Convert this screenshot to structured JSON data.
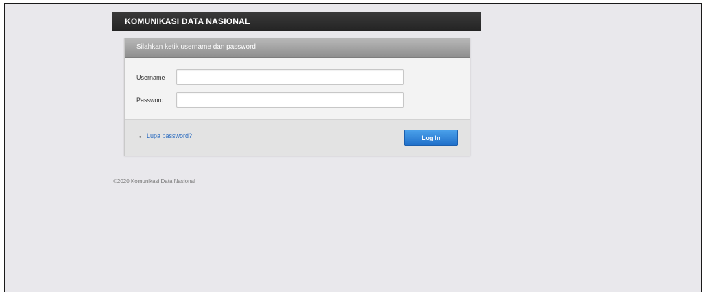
{
  "header": {
    "title": "KOMUNIKASI DATA NASIONAL"
  },
  "login_box": {
    "instruction": "Silahkan ketik username dan password",
    "username_label": "Username",
    "username_value": "",
    "password_label": "Password",
    "password_value": "",
    "forgot_link": "Lupa password?",
    "login_button": "Log In"
  },
  "footer": {
    "copyright": "©2020 Komunikasi Data Nasional"
  },
  "colors": {
    "header_bg": "#2e2e2e",
    "page_bg": "#e9e8ec",
    "button_accent": "#2f80d6",
    "link": "#2a6bbf"
  }
}
